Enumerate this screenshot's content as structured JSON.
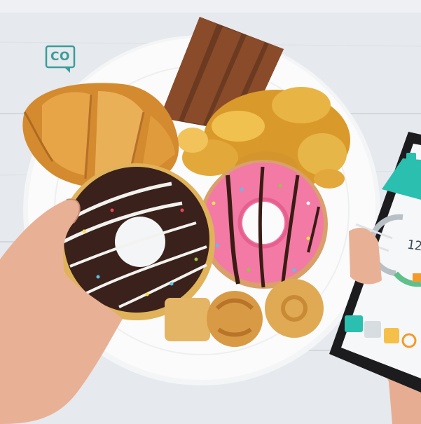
{
  "scene": {
    "background_color": "#e9ecef",
    "plate_color": "#fbfbfb"
  },
  "logo": {
    "text": "CO",
    "color": "#3a9e9a",
    "icon": "speech-bubble-icon"
  },
  "phone": {
    "readout": "12",
    "accent_color": "#2bbfb0",
    "icons": [
      "menu-icon",
      "bag-icon",
      "calendar-icon",
      "edit-icon",
      "search-icon"
    ]
  }
}
